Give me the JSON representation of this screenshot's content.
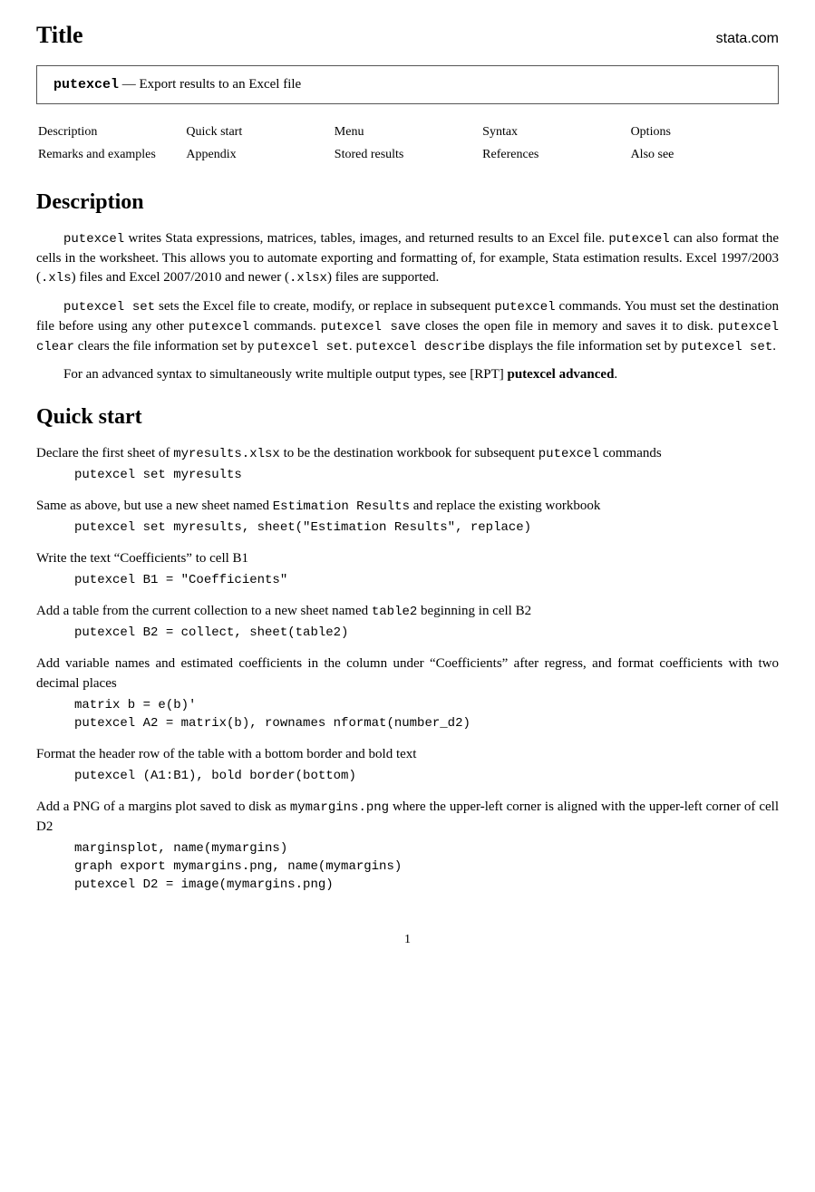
{
  "header": {
    "title": "Title",
    "domain": "stata.com"
  },
  "title_box": {
    "command": "putexcel",
    "description": " — Export results to an Excel file"
  },
  "nav": {
    "col1": [
      "Description",
      "Remarks and examples"
    ],
    "col2": [
      "Quick start",
      "Appendix"
    ],
    "col3": [
      "Menu",
      "Stored results"
    ],
    "col4": [
      "Syntax",
      "References"
    ],
    "col5": [
      "Options",
      "Also see"
    ]
  },
  "description": {
    "heading": "Description",
    "para1": "putexcel writes Stata expressions, matrices, tables, images, and returned results to an Excel file. putexcel can also format the cells in the worksheet. This allows you to automate exporting and formatting of, for example, Stata estimation results. Excel 1997/2003 (.xls) files and Excel 2007/2010 and newer (.xlsx) files are supported.",
    "para2": "putexcel set sets the Excel file to create, modify, or replace in subsequent putexcel commands. You must set the destination file before using any other putexcel commands. putexcel save closes the open file in memory and saves it to disk. putexcel clear clears the file information set by putexcel set. putexcel describe displays the file information set by putexcel set.",
    "advanced": "For an advanced syntax to simultaneously write multiple output types, see [RPT] putexcel advanced."
  },
  "quickstart": {
    "heading": "Quick start",
    "items": [
      {
        "text": "Declare the first sheet of myresults.xlsx to be the destination workbook for subsequent putexcel commands",
        "code": [
          "putexcel set myresults"
        ]
      },
      {
        "text": "Same as above, but use a new sheet named Estimation Results and replace the existing workbook",
        "code": [
          "putexcel set myresults, sheet(\"Estimation Results\", replace)"
        ]
      },
      {
        "text": "Write the text “Coefficients” to cell B1",
        "code": [
          "putexcel B1 = \"Coefficients\""
        ]
      },
      {
        "text": "Add a table from the current collection to a new sheet named table2 beginning in cell B2",
        "code": [
          "putexcel B2 = collect, sheet(table2)"
        ]
      },
      {
        "text": "Add variable names and estimated coefficients in the column under “Coefficients” after regress, and format coefficients with two decimal places",
        "code": [
          "matrix b = e(b)'",
          "putexcel A2 = matrix(b), rownames nformat(number_d2)"
        ]
      },
      {
        "text": "Format the header row of the table with a bottom border and bold text",
        "code": [
          "putexcel (A1:B1), bold border(bottom)"
        ]
      },
      {
        "text": "Add a PNG of a margins plot saved to disk as mymargins.png where the upper-left corner is aligned with the upper-left corner of cell D2",
        "code": [
          "marginsplot, name(mymargins)",
          "graph export mymargins.png, name(mymargins)",
          "putexcel D2 = image(mymargins.png)"
        ]
      }
    ]
  },
  "page_number": "1"
}
